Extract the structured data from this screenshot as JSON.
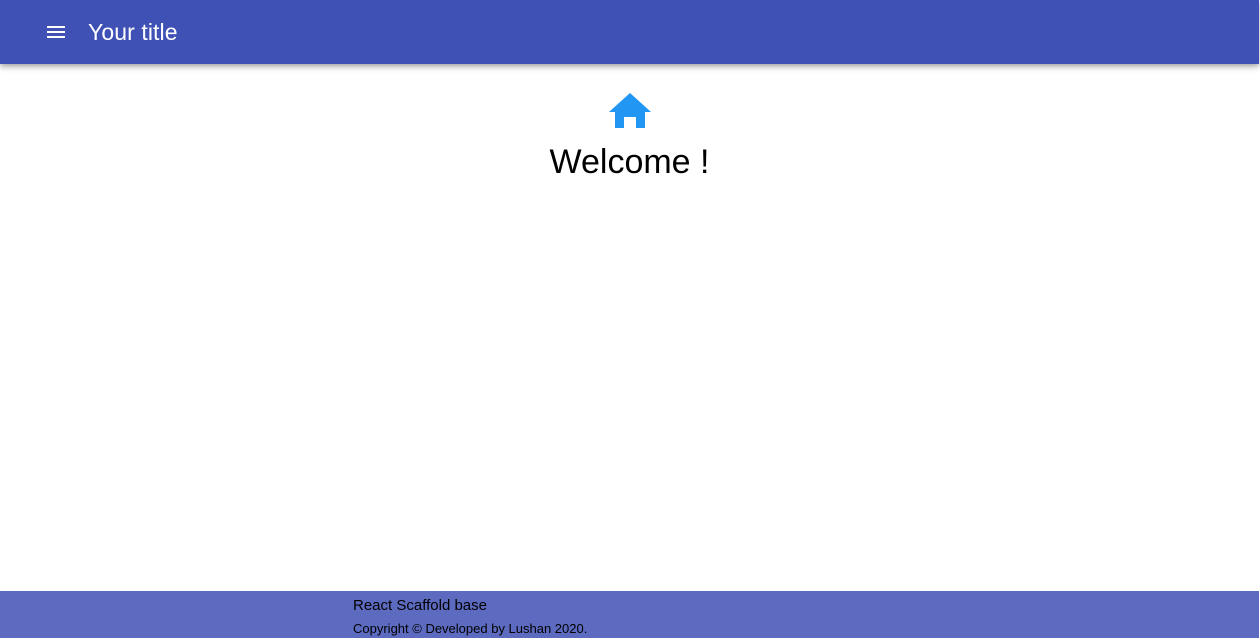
{
  "appbar": {
    "title": "Your title",
    "menu_icon": "menu-icon",
    "color": "#3f51b5"
  },
  "main": {
    "icon": "home-icon",
    "icon_color": "#2196f3",
    "heading": "Welcome !"
  },
  "footer": {
    "title": "React Scaffold base",
    "copyright": "Copyright © Developed by Lushan 2020.",
    "color": "#5c6bc0"
  }
}
